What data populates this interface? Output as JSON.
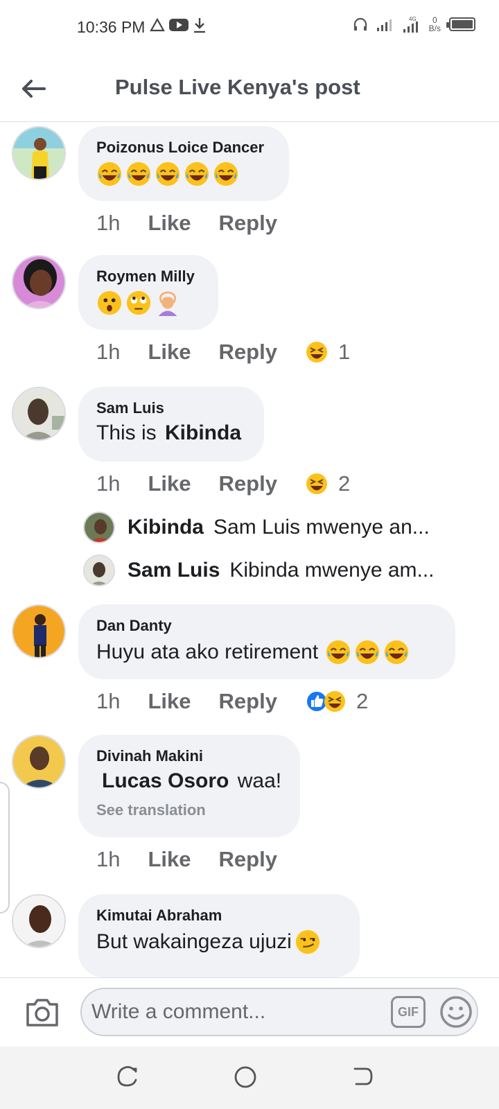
{
  "status_bar": {
    "time": "10:36 PM",
    "speed_value": "0",
    "speed_unit": "B/s",
    "network": "4G"
  },
  "header": {
    "title": "Pulse Live Kenya's post"
  },
  "comments": [
    {
      "author": "Poizonus Loice Dancer",
      "time": "1h",
      "like": "Like",
      "reply": "Reply"
    },
    {
      "author": "Roymen Milly",
      "time": "1h",
      "like": "Like",
      "reply": "Reply",
      "reaction_count": "1"
    },
    {
      "author": "Sam Luis",
      "text_prefix": "This is ",
      "text_bold": "Kibinda",
      "time": "1h",
      "like": "Like",
      "reply": "Reply",
      "reaction_count": "2",
      "replies": [
        {
          "name": "Kibinda",
          "text": "Sam Luis mwenye an..."
        },
        {
          "name": "Sam Luis",
          "text": "Kibinda mwenye am..."
        }
      ]
    },
    {
      "author": "Dan Danty",
      "text": "Huyu ata ako retirement",
      "time": "1h",
      "like": "Like",
      "reply": "Reply",
      "reaction_count": "2"
    },
    {
      "author": "Divinah Makini",
      "text_bold": "Lucas Osoro",
      "text_suffix": " waa!",
      "see_translation": "See translation",
      "time": "1h",
      "like": "Like",
      "reply": "Reply"
    },
    {
      "author": "Kimutai Abraham",
      "text": "But wakaingeza ujuzi"
    }
  ],
  "composer": {
    "placeholder": "Write a comment...",
    "gif_label": "GIF"
  },
  "icons": {
    "back": "arrow-left-icon",
    "camera": "camera-icon",
    "sticker": "smiley-icon",
    "laugh": "laughing-emoji",
    "haha": "haha-reaction",
    "like": "like-reaction"
  },
  "colors": {
    "bubble": "#f0f2f5",
    "meta": "#65676b",
    "like_blue": "#1877f2",
    "emoji_yellow": "#fcc21b"
  }
}
